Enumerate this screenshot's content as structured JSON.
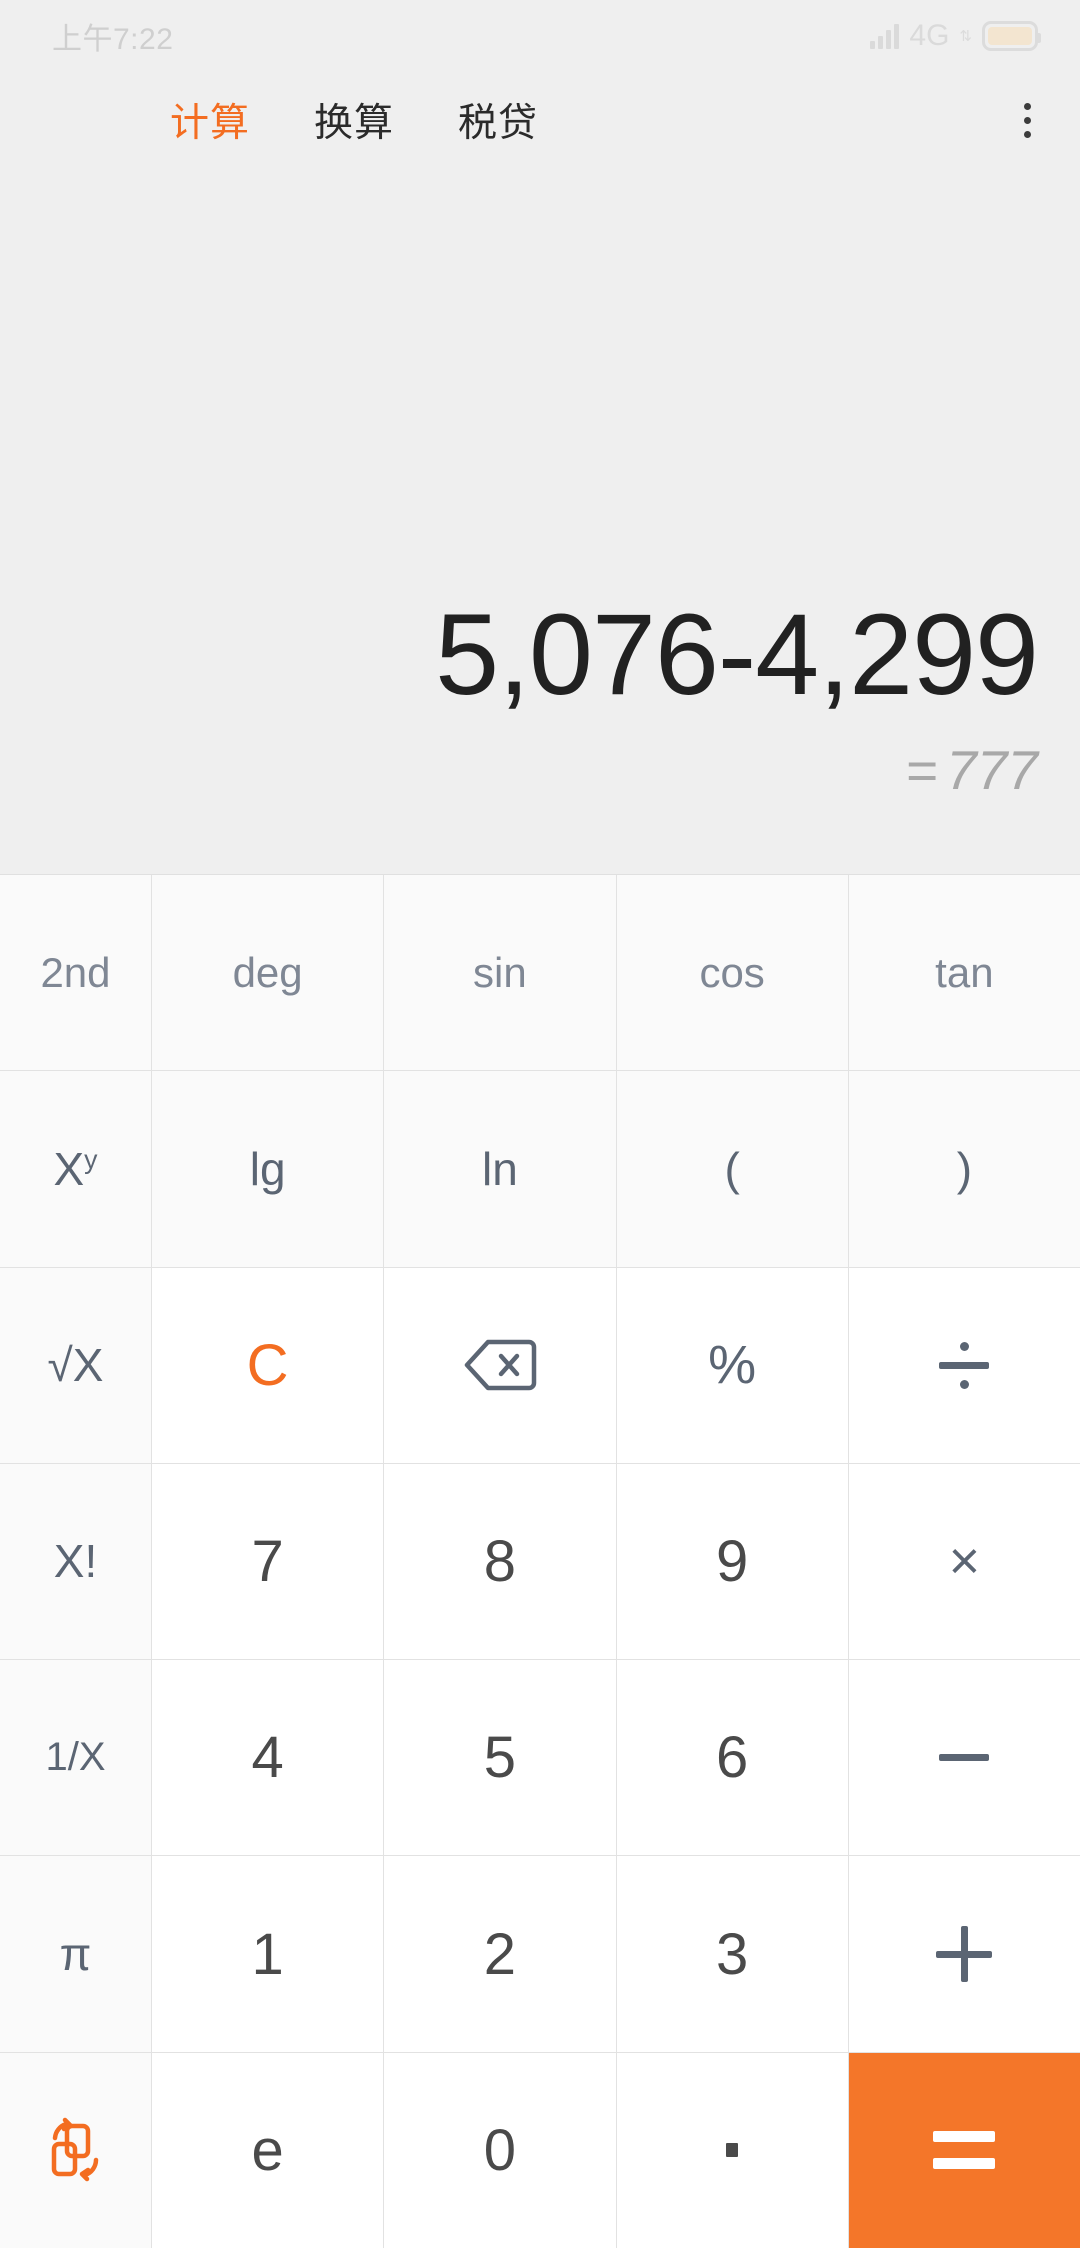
{
  "status_bar": {
    "time": "上午7:22",
    "network": "4G",
    "signal_icon": "signal-bars-icon",
    "data_arrows_icon": "data-transfer-arrows-icon",
    "battery_icon": "battery-icon"
  },
  "tabs": {
    "items": [
      {
        "label": "计算",
        "active": true
      },
      {
        "label": "换算",
        "active": false
      },
      {
        "label": "税贷",
        "active": false
      }
    ],
    "overflow_icon": "more-options-icon"
  },
  "display": {
    "expression": "5,076-4,299",
    "equals_sign": "=",
    "result": "777"
  },
  "colors": {
    "accent": "#f36d21",
    "equals_button": "#f47629",
    "panel_bg": "#efefef",
    "key_bg": "#ffffff",
    "func_key_bg": "#fafafa",
    "key_text": "#5b6573",
    "num_text": "#4a4a4a",
    "sci_text": "#7f8794",
    "result_text": "#a8a8a8",
    "expression_text": "#212121"
  },
  "keypad": {
    "rows": [
      [
        {
          "label": "2nd",
          "name": "key-2nd",
          "style": "sci"
        },
        {
          "label": "deg",
          "name": "key-deg",
          "style": "sci"
        },
        {
          "label": "sin",
          "name": "key-sin",
          "style": "sci"
        },
        {
          "label": "cos",
          "name": "key-cos",
          "style": "sci"
        },
        {
          "label": "tan",
          "name": "key-tan",
          "style": "sci"
        }
      ],
      [
        {
          "label": "Xy",
          "name": "key-x-power-y",
          "style": "sci2"
        },
        {
          "label": "lg",
          "name": "key-lg",
          "style": "sci2"
        },
        {
          "label": "ln",
          "name": "key-ln",
          "style": "sci2"
        },
        {
          "label": "(",
          "name": "key-open-paren",
          "style": "sci2"
        },
        {
          "label": ")",
          "name": "key-close-paren",
          "style": "sci2"
        }
      ],
      [
        {
          "label": "√X",
          "name": "key-square-root",
          "style": "sci2"
        },
        {
          "label": "C",
          "name": "key-clear",
          "style": "accent"
        },
        {
          "label": "",
          "name": "key-backspace",
          "style": "icon-backspace"
        },
        {
          "label": "%",
          "name": "key-percent",
          "style": "op"
        },
        {
          "label": "÷",
          "name": "key-divide",
          "style": "icon-divide"
        }
      ],
      [
        {
          "label": "X!",
          "name": "key-factorial",
          "style": "sci2"
        },
        {
          "label": "7",
          "name": "key-7",
          "style": "num"
        },
        {
          "label": "8",
          "name": "key-8",
          "style": "num"
        },
        {
          "label": "9",
          "name": "key-9",
          "style": "num"
        },
        {
          "label": "×",
          "name": "key-multiply",
          "style": "op"
        }
      ],
      [
        {
          "label": "1/X",
          "name": "key-reciprocal",
          "style": "sci2"
        },
        {
          "label": "4",
          "name": "key-4",
          "style": "num"
        },
        {
          "label": "5",
          "name": "key-5",
          "style": "num"
        },
        {
          "label": "6",
          "name": "key-6",
          "style": "num"
        },
        {
          "label": "−",
          "name": "key-subtract",
          "style": "icon-minus"
        }
      ],
      [
        {
          "label": "π",
          "name": "key-pi",
          "style": "sci2"
        },
        {
          "label": "1",
          "name": "key-1",
          "style": "num"
        },
        {
          "label": "2",
          "name": "key-2",
          "style": "num"
        },
        {
          "label": "3",
          "name": "key-3",
          "style": "num"
        },
        {
          "label": "+",
          "name": "key-add",
          "style": "icon-plus"
        }
      ],
      [
        {
          "label": "",
          "name": "key-swap-layout",
          "style": "icon-swap"
        },
        {
          "label": "e",
          "name": "key-e",
          "style": "num"
        },
        {
          "label": "0",
          "name": "key-0",
          "style": "num"
        },
        {
          "label": ".",
          "name": "key-decimal",
          "style": "icon-dot"
        },
        {
          "label": "=",
          "name": "key-equals",
          "style": "icon-equals"
        }
      ]
    ]
  }
}
